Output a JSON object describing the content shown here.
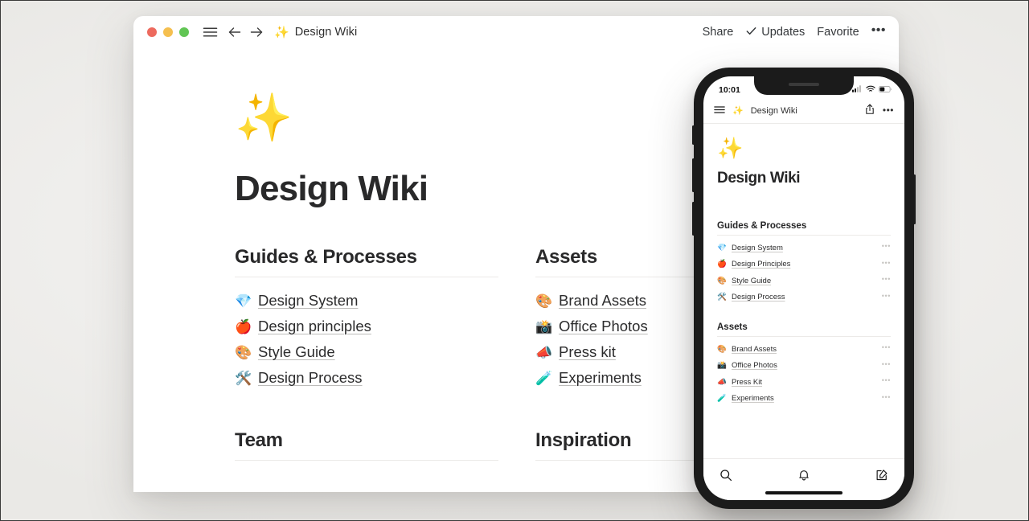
{
  "desktop": {
    "titlebar": {
      "window_controls": [
        "close",
        "minimize",
        "maximize"
      ],
      "menu_icon": "hamburger-icon",
      "back_icon": "arrow-left-icon",
      "forward_icon": "arrow-right-icon",
      "doc_emoji": "✨",
      "doc_title": "Design Wiki",
      "share_label": "Share",
      "updates_label": "Updates",
      "updates_check": "✓",
      "favorite_label": "Favorite",
      "more_label": "•••"
    },
    "page": {
      "emoji": "✨",
      "title": "Design Wiki",
      "sections": [
        {
          "heading": "Guides & Processes",
          "items": [
            {
              "emoji": "💎",
              "label": "Design System"
            },
            {
              "emoji": "🍎",
              "label": "Design principles"
            },
            {
              "emoji": "🎨",
              "label": "Style Guide"
            },
            {
              "emoji": "🛠️",
              "label": "Design Process"
            }
          ]
        },
        {
          "heading": "Assets",
          "items": [
            {
              "emoji": "🎨",
              "label": "Brand Assets"
            },
            {
              "emoji": "📸",
              "label": "Office Photos"
            },
            {
              "emoji": "📣",
              "label": "Press kit"
            },
            {
              "emoji": "🧪",
              "label": "Experiments"
            }
          ]
        },
        {
          "heading": "Team",
          "items": []
        },
        {
          "heading": "Inspiration",
          "items": []
        }
      ]
    }
  },
  "phone": {
    "status": {
      "time": "10:01",
      "cellular_icon": "signal-bars-icon",
      "wifi_icon": "wifi-icon",
      "battery_icon": "battery-icon"
    },
    "header": {
      "menu_icon": "hamburger-icon",
      "doc_emoji": "✨",
      "doc_title": "Design Wiki",
      "share_icon": "share-icon",
      "more_label": "•••"
    },
    "page": {
      "emoji": "✨",
      "title": "Design Wiki",
      "sections": [
        {
          "heading": "Guides & Processes",
          "items": [
            {
              "emoji": "💎",
              "label": "Design System",
              "more": "•••"
            },
            {
              "emoji": "🍎",
              "label": "Design Principles",
              "more": "•••"
            },
            {
              "emoji": "🎨",
              "label": "Style Guide",
              "more": "•••"
            },
            {
              "emoji": "🛠️",
              "label": "Design Process",
              "more": "•••"
            }
          ]
        },
        {
          "heading": "Assets",
          "items": [
            {
              "emoji": "🎨",
              "label": "Brand Assets",
              "more": "•••"
            },
            {
              "emoji": "📸",
              "label": "Office Photos",
              "more": "•••"
            },
            {
              "emoji": "📣",
              "label": "Press Kit",
              "more": "•••"
            },
            {
              "emoji": "🧪",
              "label": "Experiments",
              "more": "•••"
            }
          ]
        }
      ]
    },
    "tabbar": {
      "search_icon": "search-icon",
      "notifications_icon": "bell-icon",
      "compose_icon": "compose-icon"
    }
  },
  "colors": {
    "canvas": "#f1f0ee",
    "window": "#ffffff",
    "phone_frame": "#1b1b1b",
    "text": "#29292a",
    "rule": "#ebeae8",
    "traffic_red": "#ed6a5e",
    "traffic_yellow": "#f5bf4f",
    "traffic_green": "#61c554"
  }
}
